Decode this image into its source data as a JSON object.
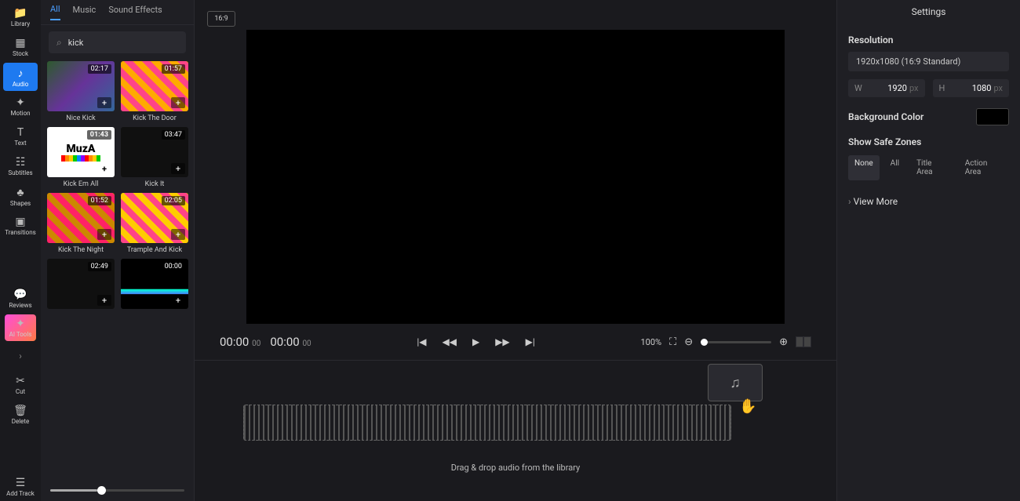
{
  "leftnav": {
    "items": [
      {
        "label": "Library",
        "icon": "📁"
      },
      {
        "label": "Stock",
        "icon": "▦"
      },
      {
        "label": "Audio",
        "icon": "♪",
        "active": true
      },
      {
        "label": "Motion",
        "icon": "✦"
      },
      {
        "label": "Text",
        "icon": "T"
      },
      {
        "label": "Subtitles",
        "icon": "☷"
      },
      {
        "label": "Shapes",
        "icon": "♣"
      },
      {
        "label": "Transitions",
        "icon": "▣"
      }
    ],
    "reviews": "Reviews",
    "ai": "AI Tools",
    "cut": "Cut",
    "delete": "Delete",
    "addtrack": "Add Track"
  },
  "tabs": [
    "All",
    "Music",
    "Sound Effects"
  ],
  "search": {
    "value": "kick"
  },
  "clips": [
    {
      "dur": "02:17",
      "title": "Nice Kick",
      "cls": "g1"
    },
    {
      "dur": "01:57",
      "title": "Kick The Door",
      "cls": "g2"
    },
    {
      "dur": "01:43",
      "title": "Kick Em All",
      "cls": "muza",
      "addlight": true
    },
    {
      "dur": "03:47",
      "title": "Kick It",
      "cls": "g5"
    },
    {
      "dur": "01:52",
      "title": "Kick The Night",
      "cls": "g3"
    },
    {
      "dur": "02:05",
      "title": "Trample And Kick",
      "cls": "g4"
    },
    {
      "dur": "02:49",
      "title": "",
      "cls": "g5"
    },
    {
      "dur": "00:00",
      "title": "",
      "cls": "g6"
    }
  ],
  "preview": {
    "ratio": "16:9"
  },
  "playback": {
    "current": "00:00",
    "current_ms": "00",
    "total": "00:00",
    "total_ms": "00",
    "zoom": "100%"
  },
  "timeline": {
    "hint": "Drag & drop audio from the library"
  },
  "settings": {
    "title": "Settings",
    "resolution_label": "Resolution",
    "resolution_value": "1920x1080 (16:9 Standard)",
    "w_label": "W",
    "w": "1920",
    "h_label": "H",
    "h": "1080",
    "px": "px",
    "bg_label": "Background Color",
    "safe_label": "Show Safe Zones",
    "safe_options": [
      "None",
      "All",
      "Title Area",
      "Action Area"
    ],
    "viewmore": "View More"
  }
}
